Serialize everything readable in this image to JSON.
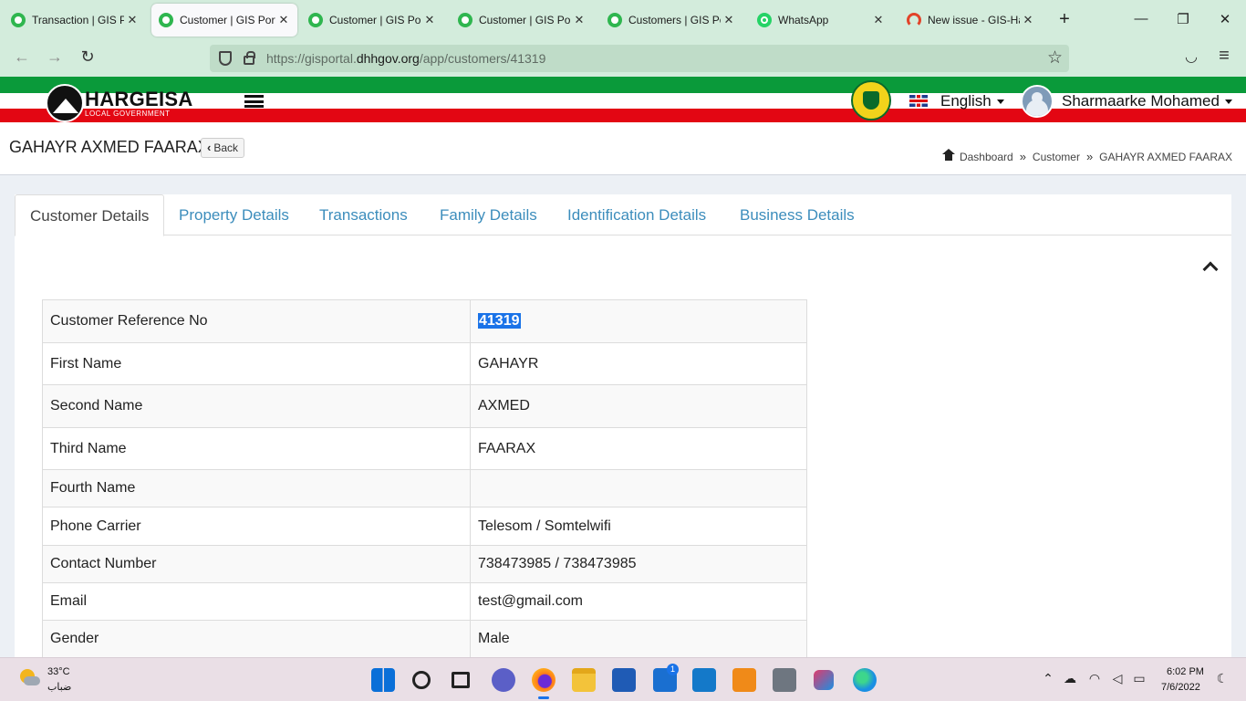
{
  "browser": {
    "tabs": [
      {
        "label": "Transaction | GIS Portal",
        "favicon": "gis-favicon"
      },
      {
        "label": "Customer | GIS Portal",
        "favicon": "gis-favicon",
        "active": true
      },
      {
        "label": "Customer | GIS Portal",
        "favicon": "gis-favicon"
      },
      {
        "label": "Customer | GIS Portal",
        "favicon": "gis-favicon"
      },
      {
        "label": "Customers | GIS Portal",
        "favicon": "gis-favicon"
      },
      {
        "label": "WhatsApp",
        "favicon": "whatsapp-favicon"
      },
      {
        "label": "New issue - GIS-Hargeisa",
        "favicon": "gitlab-favicon"
      }
    ],
    "close_glyph": "✕",
    "new_tab_glyph": "+",
    "url_prefix": "https://gisportal.",
    "url_domain": "dhhgov.org",
    "url_path": "/app/customers/41319",
    "nav": {
      "back": "←",
      "forward": "→",
      "reload": "↻",
      "star": "☆",
      "pocket": "◡",
      "menu": "≡"
    },
    "window": {
      "minimize": "—",
      "restore": "❐",
      "close": "✕"
    }
  },
  "header": {
    "logo_text": "HARGEISA",
    "logo_subtext": "LOCAL GOVERNMENT",
    "language": "English",
    "user_name": "Sharmaarke Mohamed"
  },
  "page": {
    "title": "GAHAYR AXMED FAARAX",
    "back_label": "Back",
    "breadcrumb": [
      "Dashboard",
      "Customer",
      "GAHAYR AXMED FAARAX"
    ],
    "breadcrumb_sep": "»"
  },
  "tabs": [
    "Customer Details",
    "Property Details",
    "Transactions",
    "Family Details",
    "Identification Details",
    "Business Details"
  ],
  "details": [
    {
      "label": "Customer Reference No",
      "value": "41319"
    },
    {
      "label": "First Name",
      "value": "GAHAYR"
    },
    {
      "label": "Second Name",
      "value": "AXMED"
    },
    {
      "label": "Third Name",
      "value": "FAARAX"
    },
    {
      "label": "Fourth Name",
      "value": ""
    },
    {
      "label": "Phone Carrier",
      "value": "Telesom / Somtelwifi"
    },
    {
      "label": "Contact Number",
      "value": "738473985 / 738473985"
    },
    {
      "label": "Email",
      "value": "test@gmail.com"
    },
    {
      "label": "Gender",
      "value": "Male"
    }
  ],
  "taskbar": {
    "temperature": "33°C",
    "weather": "ضباب",
    "mail_badge": "1",
    "time": "6:02 PM",
    "date": "7/6/2022",
    "colors": {
      "accent": "#1a73e8",
      "link": "#3c8dbc",
      "flag_green": "#0a9a3a",
      "flag_red": "#e30613"
    }
  }
}
